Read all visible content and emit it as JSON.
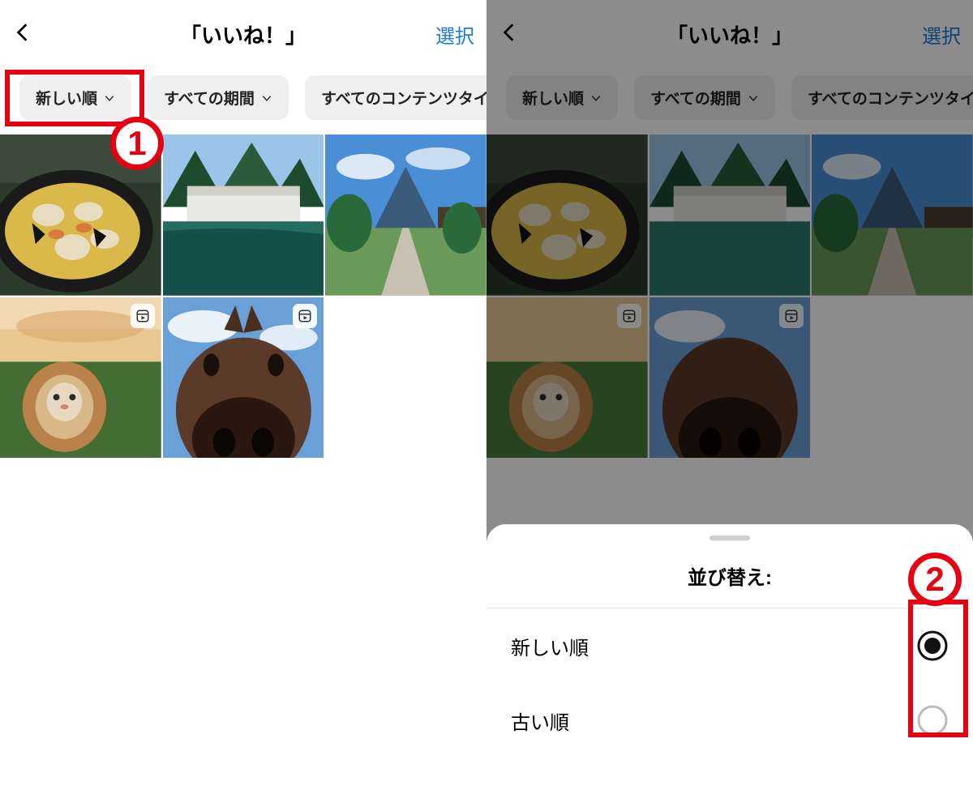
{
  "header": {
    "title": "「いいね！」",
    "select_label": "選択"
  },
  "filters": {
    "sort": "新しい順",
    "period": "すべての期間",
    "content_type": "すべてのコンテンツタイプ"
  },
  "grid": {
    "tiles": [
      {
        "name": "seafood-bowl",
        "is_reel": false
      },
      {
        "name": "waterfall-dam",
        "is_reel": false
      },
      {
        "name": "mountain-path",
        "is_reel": false
      },
      {
        "name": "lion-cat-sunset",
        "is_reel": true
      },
      {
        "name": "horse-closeup",
        "is_reel": true
      }
    ]
  },
  "sheet": {
    "title": "並び替え:",
    "options": [
      {
        "label": "新しい順",
        "selected": true
      },
      {
        "label": "古い順",
        "selected": false
      }
    ]
  },
  "callouts": {
    "one": "1",
    "two": "2"
  },
  "colors": {
    "accent_link": "#1e7bd6",
    "callout_red": "#e60012"
  }
}
